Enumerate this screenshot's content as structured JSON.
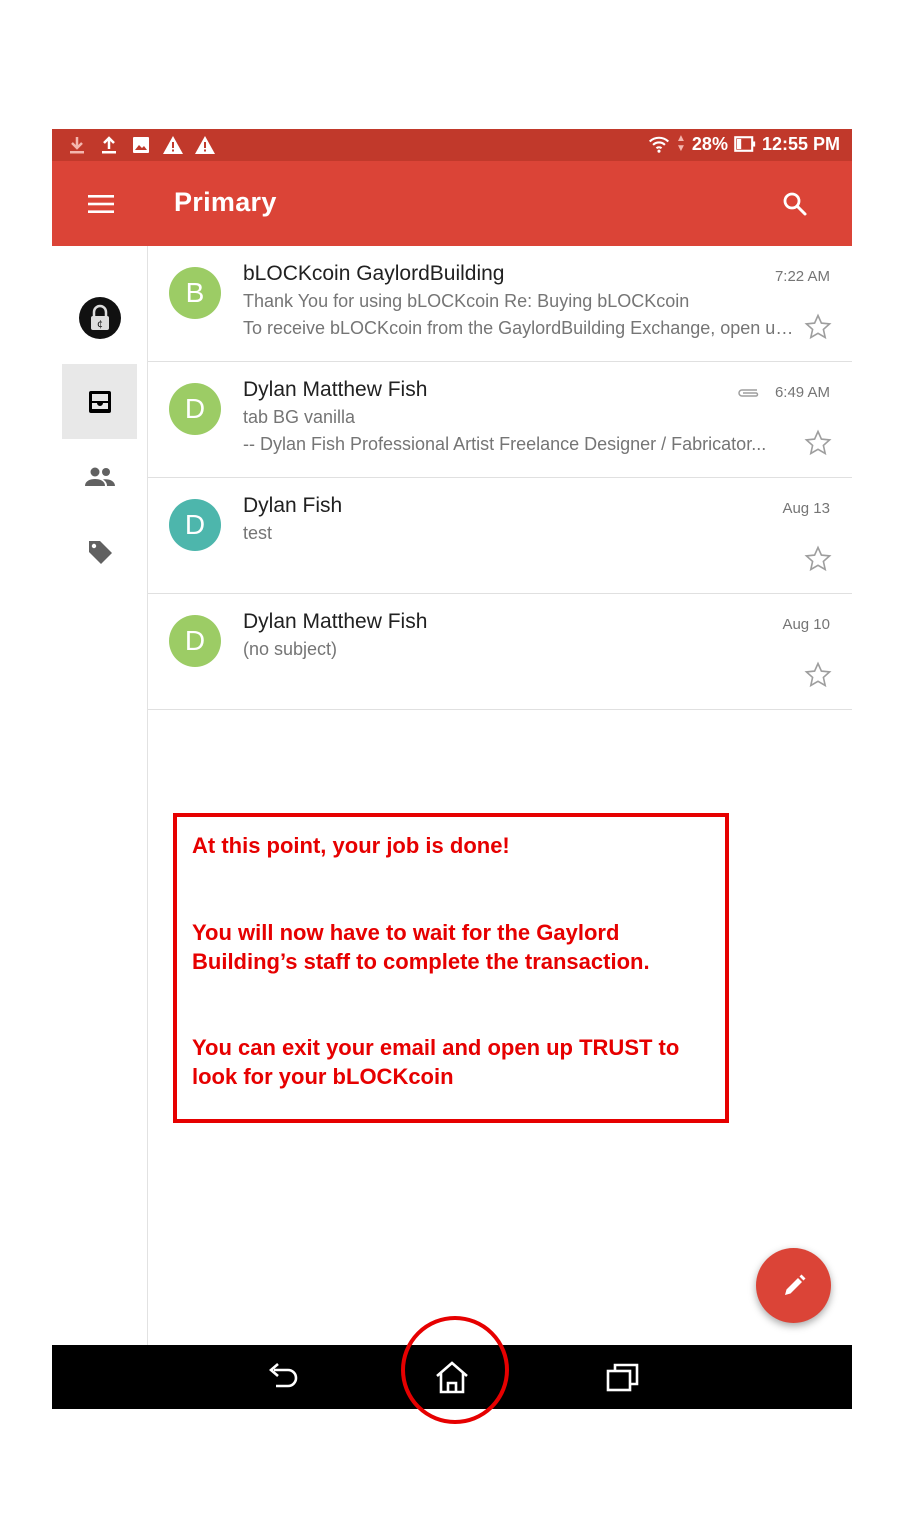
{
  "status_bar": {
    "battery": "28%",
    "time": "12:55 PM",
    "icons": [
      "download-icon",
      "upload-icon",
      "image-icon",
      "warning-icon",
      "warning-icon",
      "wifi-icon",
      "battery-icon"
    ]
  },
  "app_bar": {
    "title": "Primary"
  },
  "emails": [
    {
      "initial": "B",
      "avatar_color": "#9ccc65",
      "sender": "bLOCKcoin GaylordBuilding",
      "subject": "Thank You for using bLOCKcoin Re: Buying bLOCKcoin",
      "snippet": "To receive bLOCKcoin from the GaylordBuilding Exchange, open up your TRUST wallet",
      "date": "7:22 AM",
      "attachment": false
    },
    {
      "initial": "D",
      "avatar_color": "#9ccc65",
      "sender": "Dylan Matthew Fish",
      "subject": "tab BG vanilla",
      "snippet": "-- Dylan Fish Professional Artist Freelance Designer / Fabricator...",
      "date": "6:49 AM",
      "attachment": true
    },
    {
      "initial": "D",
      "avatar_color": "#4db6ac",
      "sender": "Dylan Fish",
      "subject": "test",
      "snippet": "",
      "date": "Aug 13",
      "attachment": false
    },
    {
      "initial": "D",
      "avatar_color": "#9ccc65",
      "sender": "Dylan Matthew Fish",
      "subject": "(no subject)",
      "snippet": "",
      "date": "Aug 10",
      "attachment": false
    }
  ],
  "annotation": {
    "line1": "At this point, your job is done!",
    "line2": "You will now have to wait for the Gaylord Building’s staff to complete the transaction.",
    "line3": "You can exit your email and open up TRUST to look for your bLOCKcoin"
  },
  "colors": {
    "status_bar": "#c1392b",
    "app_bar": "#db4437",
    "annotation": "#e60000"
  }
}
